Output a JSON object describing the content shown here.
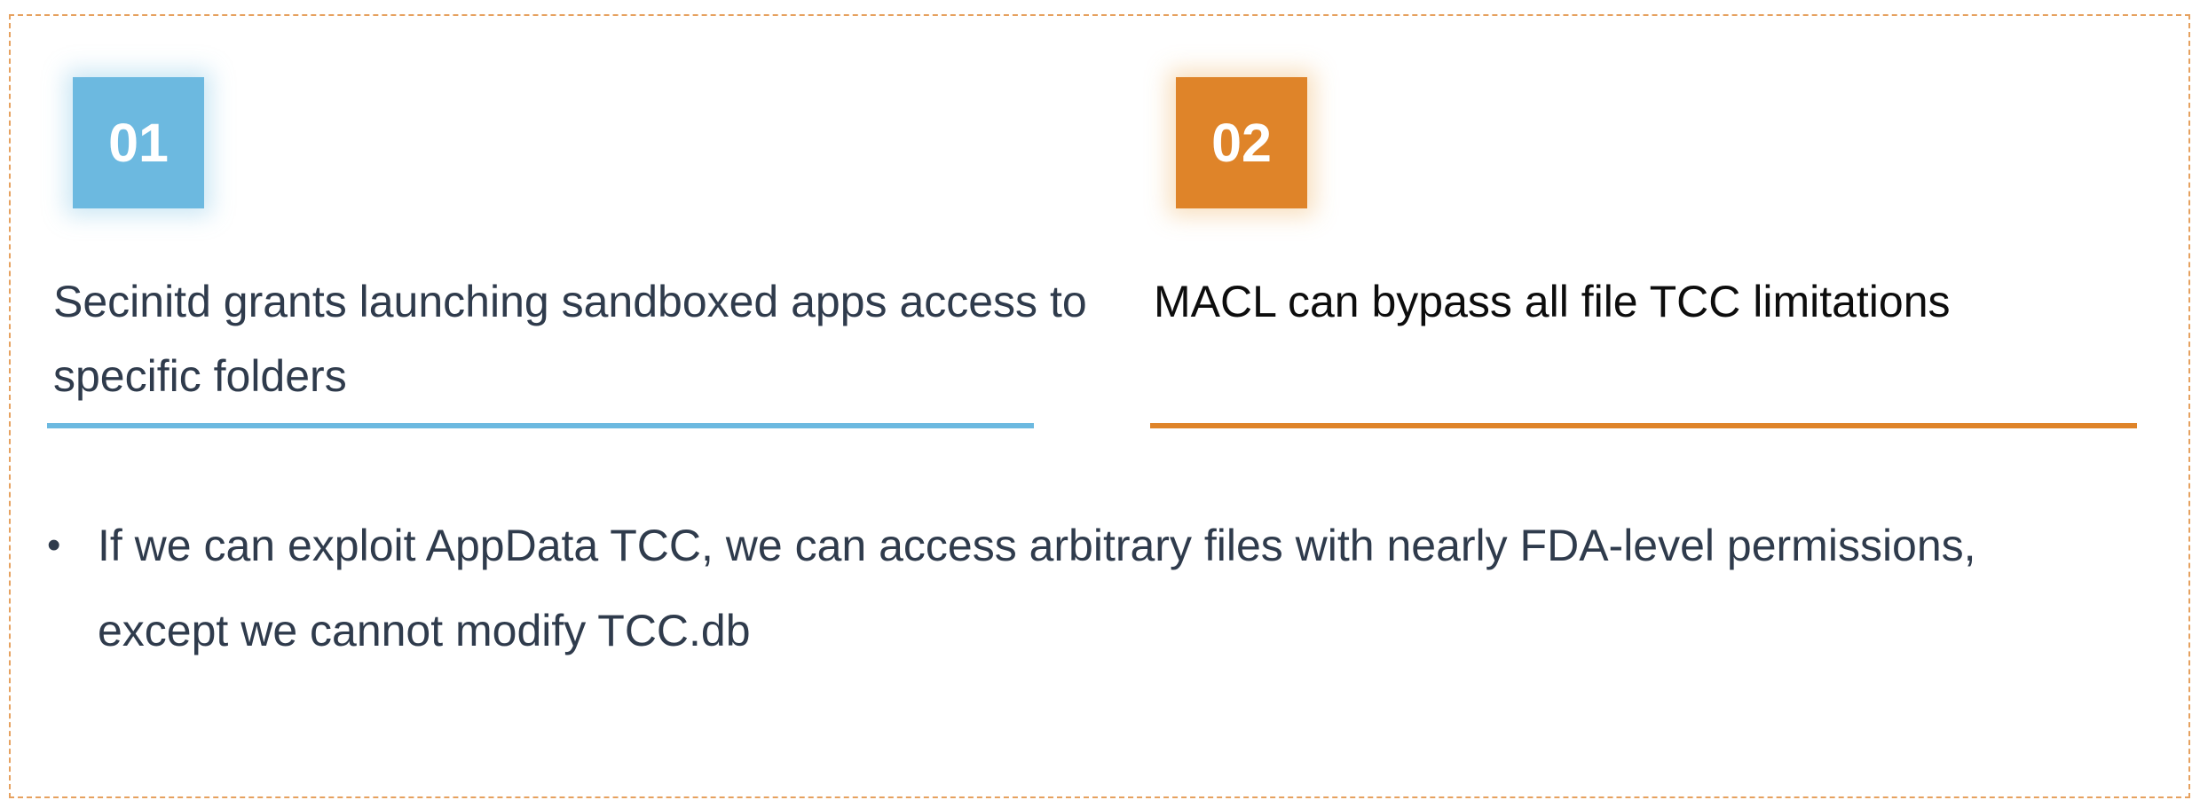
{
  "cards": [
    {
      "number": "01",
      "text": "Secinitd grants launching sandboxed apps access to specific folders",
      "accent_color": "#6cb9e0"
    },
    {
      "number": "02",
      "text": "MACL can bypass all file TCC limitations",
      "accent_color": "#df8429"
    }
  ],
  "bullets": [
    {
      "marker": "•",
      "text": "If we can exploit AppData TCC, we can access arbitrary files with nearly FDA-level permissions, except we cannot modify TCC.db"
    }
  ],
  "frame_border_color": "#e6a15f"
}
